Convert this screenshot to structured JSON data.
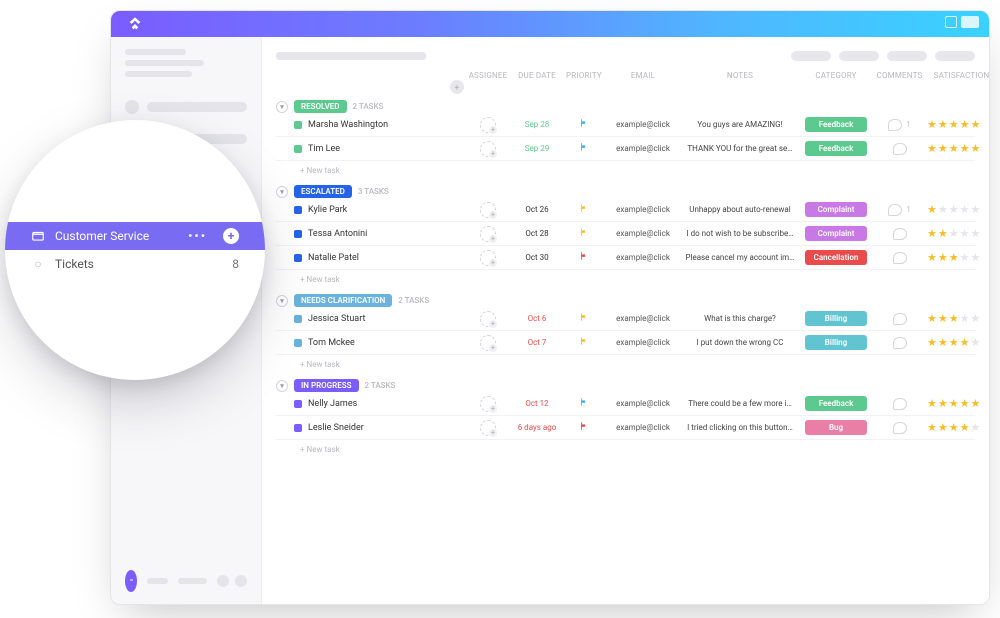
{
  "sidebar": {
    "active_label": "Customer Service",
    "sub_label": "Tickets",
    "sub_count": "8"
  },
  "columns": {
    "assignee": "ASSIGNEE",
    "due": "DUE DATE",
    "priority": "PRIORITY",
    "email": "EMAIL",
    "notes": "NOTES",
    "category": "CATEGORY",
    "comments": "COMMENTS",
    "satisfaction": "SATISFACTION LEVEL"
  },
  "common": {
    "new_task": "+ New task",
    "email": "example@click"
  },
  "category_colors": {
    "Feedback": "#5cc98f",
    "Complaint": "#c979e5",
    "Cancellation": "#e94c4c",
    "Billing": "#61c4d0",
    "Bug": "#ea7fa6"
  },
  "sections": [
    {
      "id": "RESOLVED",
      "label": "RESOLVED",
      "count_label": "2 TASKS",
      "rows": [
        {
          "name": "Marsha Washington",
          "due": "Sep 28",
          "due_tone": "green",
          "flag": "#3bb0ff",
          "email": "example@click",
          "notes": "You guys are AMAZING!",
          "category": "Feedback",
          "comments": "1",
          "stars": 5
        },
        {
          "name": "Tim Lee",
          "due": "Sep 29",
          "due_tone": "green",
          "flag": "#3bb0ff",
          "email": "example@click",
          "notes": "THANK YOU for the great se…",
          "category": "Feedback",
          "comments": "",
          "stars": 5
        }
      ]
    },
    {
      "id": "ESCALATED",
      "label": "ESCALATED",
      "count_label": "3 TASKS",
      "rows": [
        {
          "name": "Kylie Park",
          "due": "Oct 26",
          "due_tone": "grey",
          "flag": "#f7bd26",
          "email": "example@click",
          "notes": "Unhappy about auto-renewal",
          "category": "Complaint",
          "comments": "1",
          "stars": 1
        },
        {
          "name": "Tessa Antonini",
          "due": "Oct 28",
          "due_tone": "grey",
          "flag": "#f7bd26",
          "email": "example@click",
          "notes": "I do not wish to be subscribe…",
          "category": "Complaint",
          "comments": "",
          "stars": 2
        },
        {
          "name": "Natalie Patel",
          "due": "Oct 30",
          "due_tone": "grey",
          "flag": "#e94c4c",
          "email": "example@click",
          "notes": "Please cancel my account im…",
          "category": "Cancellation",
          "comments": "",
          "stars": 3
        }
      ]
    },
    {
      "id": "NEEDS-CLARIFICATION",
      "label": "NEEDS CLARIFICATION",
      "count_label": "2 TASKS",
      "rows": [
        {
          "name": "Jessica Stuart",
          "due": "Oct 6",
          "due_tone": "red",
          "flag": "#f7bd26",
          "email": "example@click",
          "notes": "What is this charge?",
          "category": "Billing",
          "comments": "",
          "stars": 3
        },
        {
          "name": "Tom Mckee",
          "due": "Oct 7",
          "due_tone": "red",
          "flag": "#f7bd26",
          "email": "example@click",
          "notes": "I put down the wrong CC",
          "category": "Billing",
          "comments": "",
          "stars": 4
        }
      ]
    },
    {
      "id": "IN-PROGRESS",
      "label": "IN PROGRESS",
      "count_label": "2 TASKS",
      "rows": [
        {
          "name": "Nelly James",
          "due": "Oct 12",
          "due_tone": "red",
          "flag": "#3bb0ff",
          "email": "example@click",
          "notes": "There could be a few more i…",
          "category": "Feedback",
          "comments": "",
          "stars": 5
        },
        {
          "name": "Leslie Sneider",
          "due": "6 days ago",
          "due_tone": "red",
          "flag": "#e94c4c",
          "email": "example@click",
          "notes": "I tried clicking on this button…",
          "category": "Bug",
          "comments": "",
          "stars": 4
        }
      ]
    }
  ]
}
